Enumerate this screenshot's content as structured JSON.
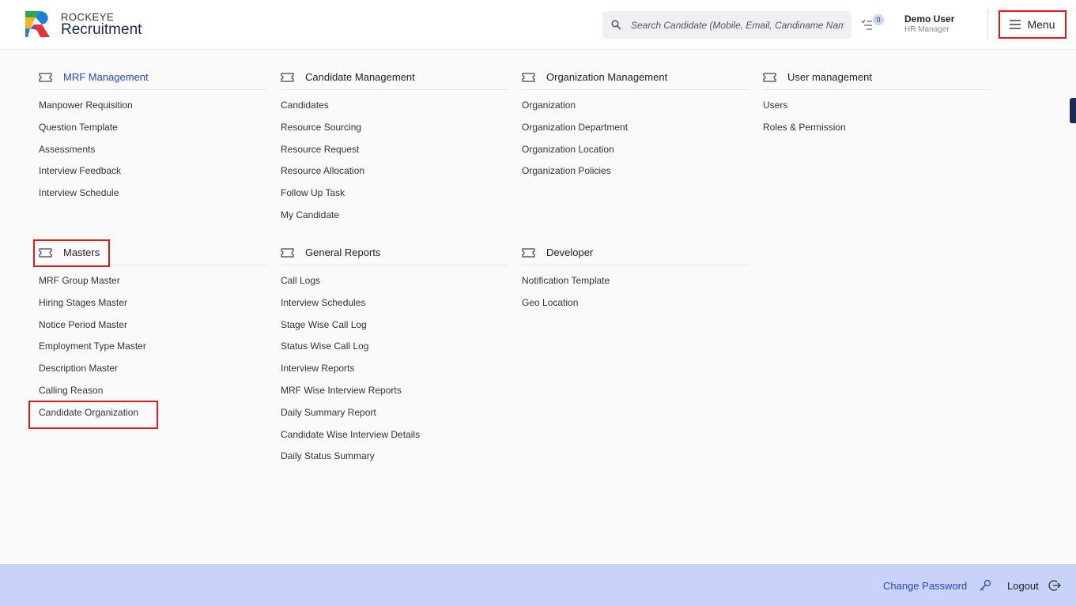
{
  "brand": {
    "small": "ROCKEYE",
    "big": "Recruitment"
  },
  "search": {
    "placeholder": "Search Candidate (Mobile, Email, Candiname Name)"
  },
  "notifications": {
    "count": "0"
  },
  "user": {
    "name": "Demo User",
    "role": "HR Manager"
  },
  "menu_button": {
    "label": "Menu"
  },
  "sections": {
    "mrf": {
      "title": "MRF Management",
      "items": [
        "Manpower Requisition",
        "Question Template",
        "Assessments",
        "Interview Feedback",
        "Interview Schedule"
      ]
    },
    "candidate": {
      "title": "Candidate Management",
      "items": [
        "Candidates",
        "Resource Sourcing",
        "Resource Request",
        "Resource Allocation",
        "Follow Up Task",
        "My Candidate"
      ]
    },
    "organization": {
      "title": "Organization Management",
      "items": [
        "Organization",
        "Organization Department",
        "Organization Location",
        "Organization Policies"
      ]
    },
    "users": {
      "title": "User management",
      "items": [
        "Users",
        "Roles & Permission"
      ]
    },
    "masters": {
      "title": "Masters",
      "items": [
        "MRF Group Master",
        "Hiring Stages Master",
        "Notice Period Master",
        "Employment Type Master",
        "Description Master",
        "Calling Reason",
        "Candidate Organization"
      ]
    },
    "reports": {
      "title": "General Reports",
      "items": [
        "Call Logs",
        "Interview Schedules",
        "Stage Wise Call Log",
        "Status Wise Call Log",
        "Interview Reports",
        "MRF Wise Interview Reports",
        "Daily Summary Report",
        "Candidate Wise Interview Details",
        "Daily Status Summary"
      ]
    },
    "developer": {
      "title": "Developer",
      "items": [
        "Notification Template",
        "Geo Location"
      ]
    }
  },
  "footer": {
    "change_password": "Change Password",
    "logout": "Logout"
  },
  "colors": {
    "accent": "#2448c8",
    "highlight": "#e01a1a",
    "footer_bg": "#c9d3fa"
  }
}
